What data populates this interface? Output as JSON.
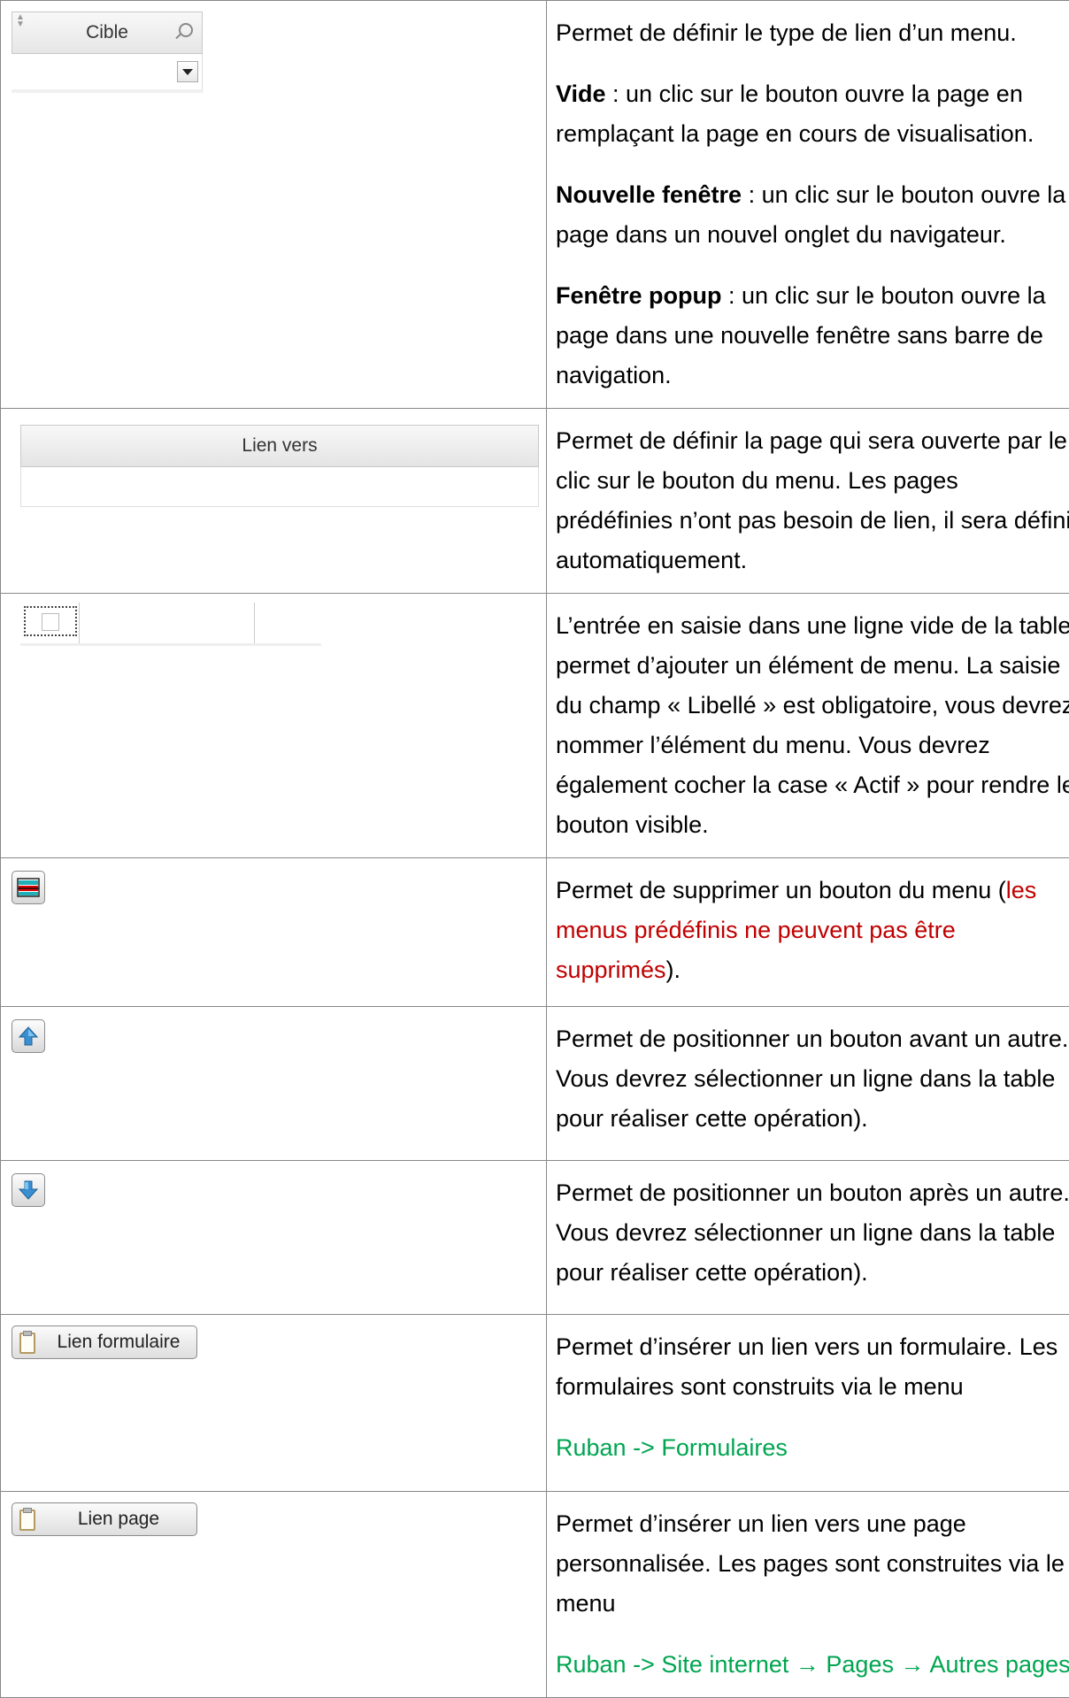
{
  "rows": [
    {
      "left": {
        "header_label": "Cible"
      },
      "paragraphs": [
        {
          "text": "Permet de définir le type de lien d’un menu."
        },
        {
          "bold": "Vide",
          "text": " : un clic sur le bouton ouvre la page en remplaçant la page en cours de visualisation."
        },
        {
          "bold": "Nouvelle fenêtre",
          "text": " : un clic sur le bouton ouvre la page dans un nouvel onglet du navigateur."
        },
        {
          "bold": "Fenêtre popup",
          "text": " : un clic sur le bouton ouvre la page dans une nouvelle fenêtre sans barre de navigation."
        }
      ]
    },
    {
      "left": {
        "header_label": "Lien vers"
      },
      "paragraphs": [
        {
          "text": "Permet de définir la page qui sera ouverte par le clic sur le bouton du menu. Les pages prédéfinies n’ont pas besoin de lien, il sera défini automatiquement."
        }
      ]
    },
    {
      "paragraphs": [
        {
          "text": "L’entrée en saisie dans une ligne vide de la table permet d’ajouter un élément de menu. La saisie du champ « Libellé » est obligatoire, vous devrez nommer l’élément du menu. Vous devrez également cocher la case « Actif » pour rendre le bouton visible."
        }
      ]
    },
    {
      "left": {
        "icon": "delete-row-icon"
      },
      "paragraphs": [
        {
          "text": "Permet de supprimer un bouton du menu (",
          "red": "les menus prédéfinis ne peuvent pas être supprimés",
          "after": ")."
        }
      ]
    },
    {
      "left": {
        "icon": "arrow-up-icon"
      },
      "paragraphs": [
        {
          "text": "Permet de positionner un bouton avant un autre. Vous devrez sélectionner un ligne dans la table pour réaliser cette opération)."
        }
      ]
    },
    {
      "left": {
        "icon": "arrow-down-icon"
      },
      "paragraphs": [
        {
          "text": "Permet de positionner un bouton après un autre. Vous devrez sélectionner un ligne dans la table pour réaliser cette opération)."
        }
      ]
    },
    {
      "left": {
        "button_label": "Lien formulaire",
        "icon": "document-icon"
      },
      "paragraphs": [
        {
          "text": "Permet d’insérer un lien vers un formulaire. Les formulaires sont construits via le menu"
        },
        {
          "green": "Ruban  -> Formulaires"
        }
      ]
    },
    {
      "left": {
        "button_label": "Lien page",
        "icon": "document-icon"
      },
      "paragraphs": [
        {
          "text": "Permet d’insérer un lien vers une page personnalisée. Les pages sont construites via le menu"
        },
        {
          "green": "Ruban  -> Site internet → Pages → Autres pages"
        }
      ]
    }
  ],
  "colors": {
    "red_text": "#c00000",
    "green_text": "#00a550"
  }
}
